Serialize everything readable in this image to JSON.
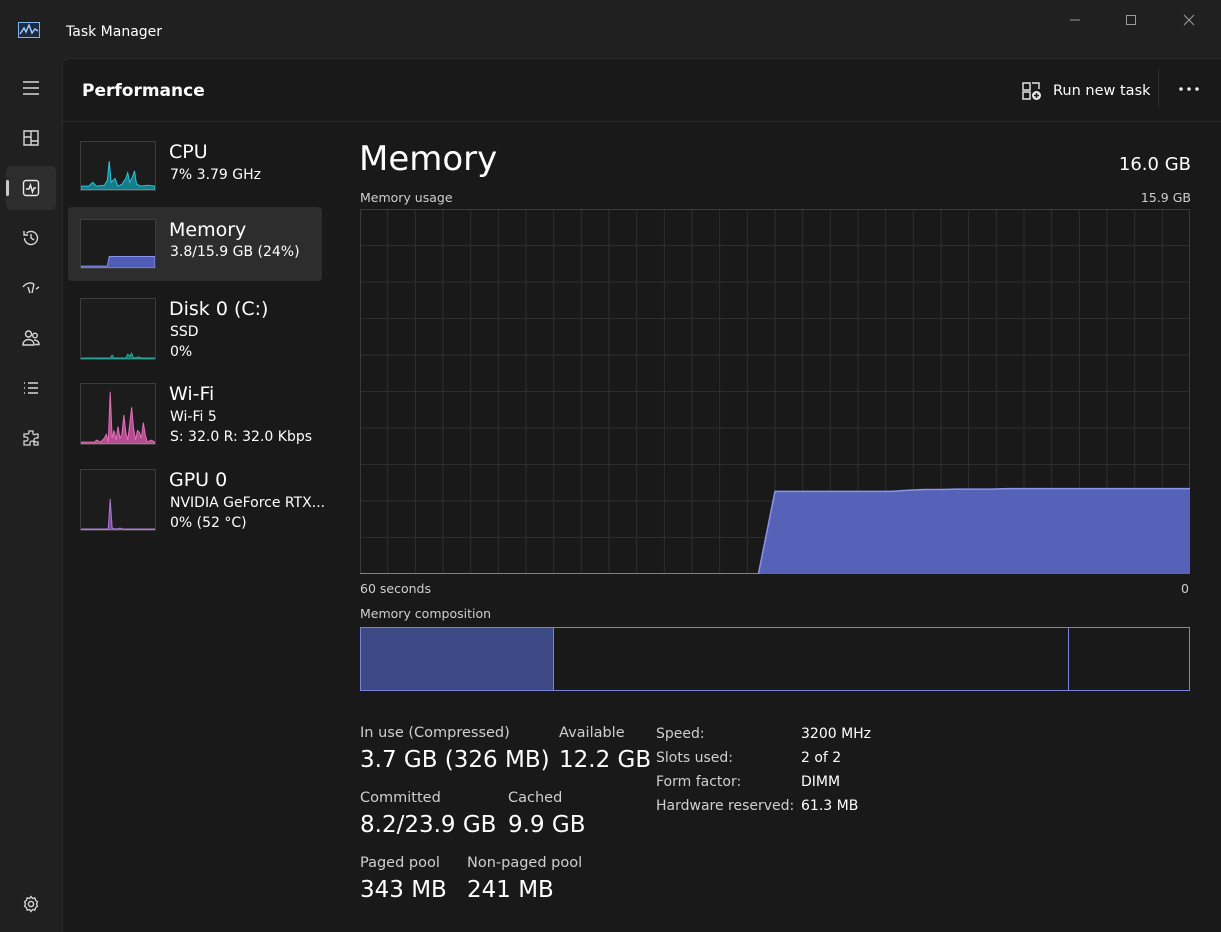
{
  "window": {
    "title": "Task Manager",
    "controls": {
      "minimize": "minimize-icon",
      "maximize": "maximize-icon",
      "close": "close-icon"
    }
  },
  "nav": {
    "items": [
      {
        "name": "hamburger-menu-icon"
      },
      {
        "name": "processes-icon"
      },
      {
        "name": "performance-icon",
        "active": true
      },
      {
        "name": "app-history-icon"
      },
      {
        "name": "startup-apps-icon"
      },
      {
        "name": "users-icon"
      },
      {
        "name": "details-icon"
      },
      {
        "name": "services-icon"
      },
      {
        "name": "settings-icon"
      }
    ]
  },
  "header": {
    "page_title": "Performance",
    "run_new_task": "Run new task",
    "more": "more-options-icon"
  },
  "resources": [
    {
      "name": "CPU",
      "line1": "7%  3.79 GHz",
      "line2": "",
      "color": "#1fb3c8"
    },
    {
      "name": "Memory",
      "line1": "3.8/15.9 GB (24%)",
      "line2": "",
      "color": "#7480e0",
      "selected": true
    },
    {
      "name": "Disk 0 (C:)",
      "line1": "SSD",
      "line2": "0%",
      "color": "#23a89b"
    },
    {
      "name": "Wi-Fi",
      "line1": "Wi-Fi 5",
      "line2": "S: 32.0  R: 32.0 Kbps",
      "color": "#e066b5"
    },
    {
      "name": "GPU 0",
      "line1": "NVIDIA GeForce RTX...",
      "line2": "0%  (52 °C)",
      "color": "#a76fc9"
    }
  ],
  "memory": {
    "title": "Memory",
    "total": "16.0 GB",
    "usage_label": "Memory usage",
    "usage_max": "15.9 GB",
    "x_start": "60 seconds",
    "x_end": "0",
    "composition_label": "Memory composition",
    "usage_series_gb": [
      0,
      0,
      0,
      0,
      0,
      0,
      0,
      0,
      0,
      0,
      0,
      0,
      0,
      0,
      0,
      0,
      0,
      0,
      0,
      0,
      0,
      0,
      0,
      0,
      0,
      3.6,
      3.6,
      3.6,
      3.6,
      3.6,
      3.6,
      3.6,
      3.6,
      3.65,
      3.68,
      3.68,
      3.7,
      3.7,
      3.7,
      3.72,
      3.72,
      3.72,
      3.72,
      3.72,
      3.72,
      3.72,
      3.72,
      3.72,
      3.72,
      3.72,
      3.72
    ],
    "usage_ymax_gb": 15.9,
    "composition": {
      "in_use_gb": 3.7,
      "modified_gb": 0.0,
      "standby_gb": 9.9,
      "free_gb": 2.3
    },
    "stats": {
      "in_use_label": "In use (Compressed)",
      "in_use_value": "3.7 GB (326 MB)",
      "available_label": "Available",
      "available_value": "12.2 GB",
      "committed_label": "Committed",
      "committed_value": "8.2/23.9 GB",
      "cached_label": "Cached",
      "cached_value": "9.9 GB",
      "paged_label": "Paged pool",
      "paged_value": "343 MB",
      "nonpaged_label": "Non-paged pool",
      "nonpaged_value": "241 MB"
    },
    "specs": [
      {
        "label": "Speed:",
        "value": "3200 MHz"
      },
      {
        "label": "Slots used:",
        "value": "2 of 2"
      },
      {
        "label": "Form factor:",
        "value": "DIMM"
      },
      {
        "label": "Hardware reserved:",
        "value": "61.3 MB"
      }
    ]
  },
  "colors": {
    "memory_fill": "#5a68c4",
    "memory_line": "#8a94ec",
    "composition_in_use": "#3d4a85",
    "grid": "#2e2e2e"
  }
}
